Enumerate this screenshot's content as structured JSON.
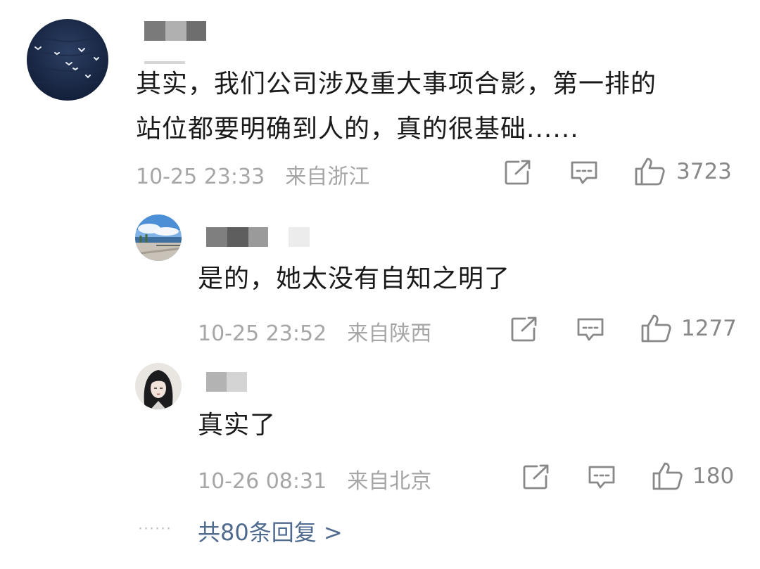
{
  "comments": [
    {
      "text_line1": "其实，我们公司涉及重大事项合影，第一排的",
      "text_line2": "站位都要明确到人的，真的很基础......",
      "time": "10-25 23:33",
      "location": "来自浙江",
      "likes": "3723"
    },
    {
      "text": "是的，她太没有自知之明了",
      "time": "10-25 23:52",
      "location": "来自陕西",
      "likes": "1277"
    },
    {
      "text": "真实了",
      "time": "10-26 08:31",
      "location": "来自北京",
      "likes": "180"
    }
  ],
  "replies_link": "共80条回复 >",
  "replies_dots": "······",
  "colors": {
    "meta": "#a6a6a6",
    "link": "#4f6a8f",
    "icon": "#888888"
  },
  "icons": [
    "share-icon",
    "comment-icon",
    "like-icon"
  ]
}
